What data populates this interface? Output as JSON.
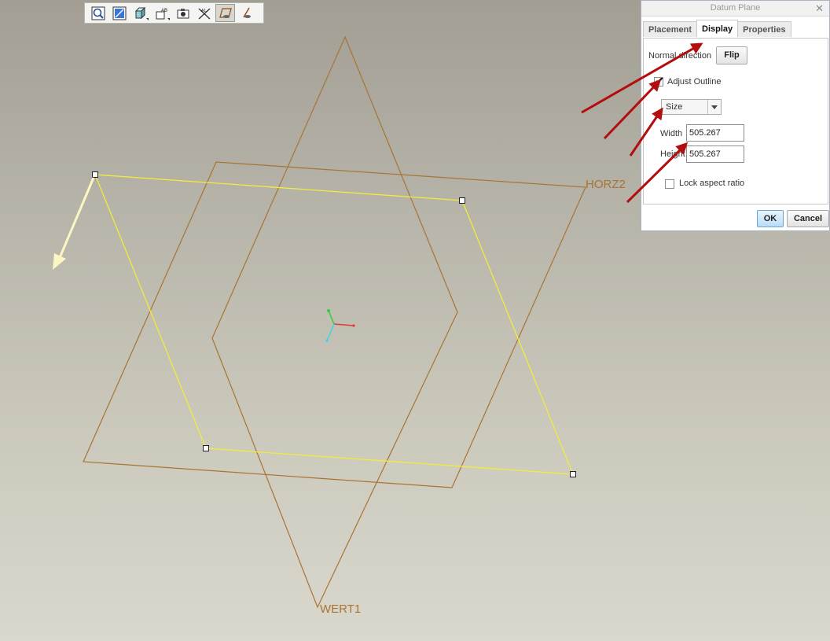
{
  "viewport": {
    "labels": {
      "horz": "HORZ2",
      "vert": "WERT1"
    }
  },
  "toolbar": {
    "buttons": [
      {
        "icon": "zoom-view-icon"
      },
      {
        "icon": "sketch-plane-icon"
      },
      {
        "icon": "display-style-icon"
      },
      {
        "icon": "annotation-display-icon"
      },
      {
        "icon": "camera-icon"
      },
      {
        "icon": "datum-axis-display-icon"
      },
      {
        "icon": "datum-plane-display-icon"
      },
      {
        "icon": "datum-point-display-icon"
      }
    ]
  },
  "dialog": {
    "title": "Datum Plane",
    "close_glyph": "✕",
    "tabs": [
      "Placement",
      "Display",
      "Properties"
    ],
    "selected_tab": "Display",
    "normal_direction_label": "Normal direction",
    "flip_label": "Flip",
    "adjust_outline_label": "Adjust Outline",
    "adjust_outline_checked": true,
    "size_mode": "Size",
    "width_label": "Width",
    "width_value": "505.267",
    "height_label": "Height",
    "height_value": "505.267",
    "lock_aspect_label": "Lock aspect ratio",
    "lock_aspect_checked": false,
    "ok_label": "OK",
    "cancel_label": "Cancel"
  },
  "colors": {
    "datum_plane": "#a87434",
    "selected_outline": "#f2ec3c",
    "annotation_arrow": "#b40d0d",
    "direction_arrow": "#fbf6c4"
  }
}
